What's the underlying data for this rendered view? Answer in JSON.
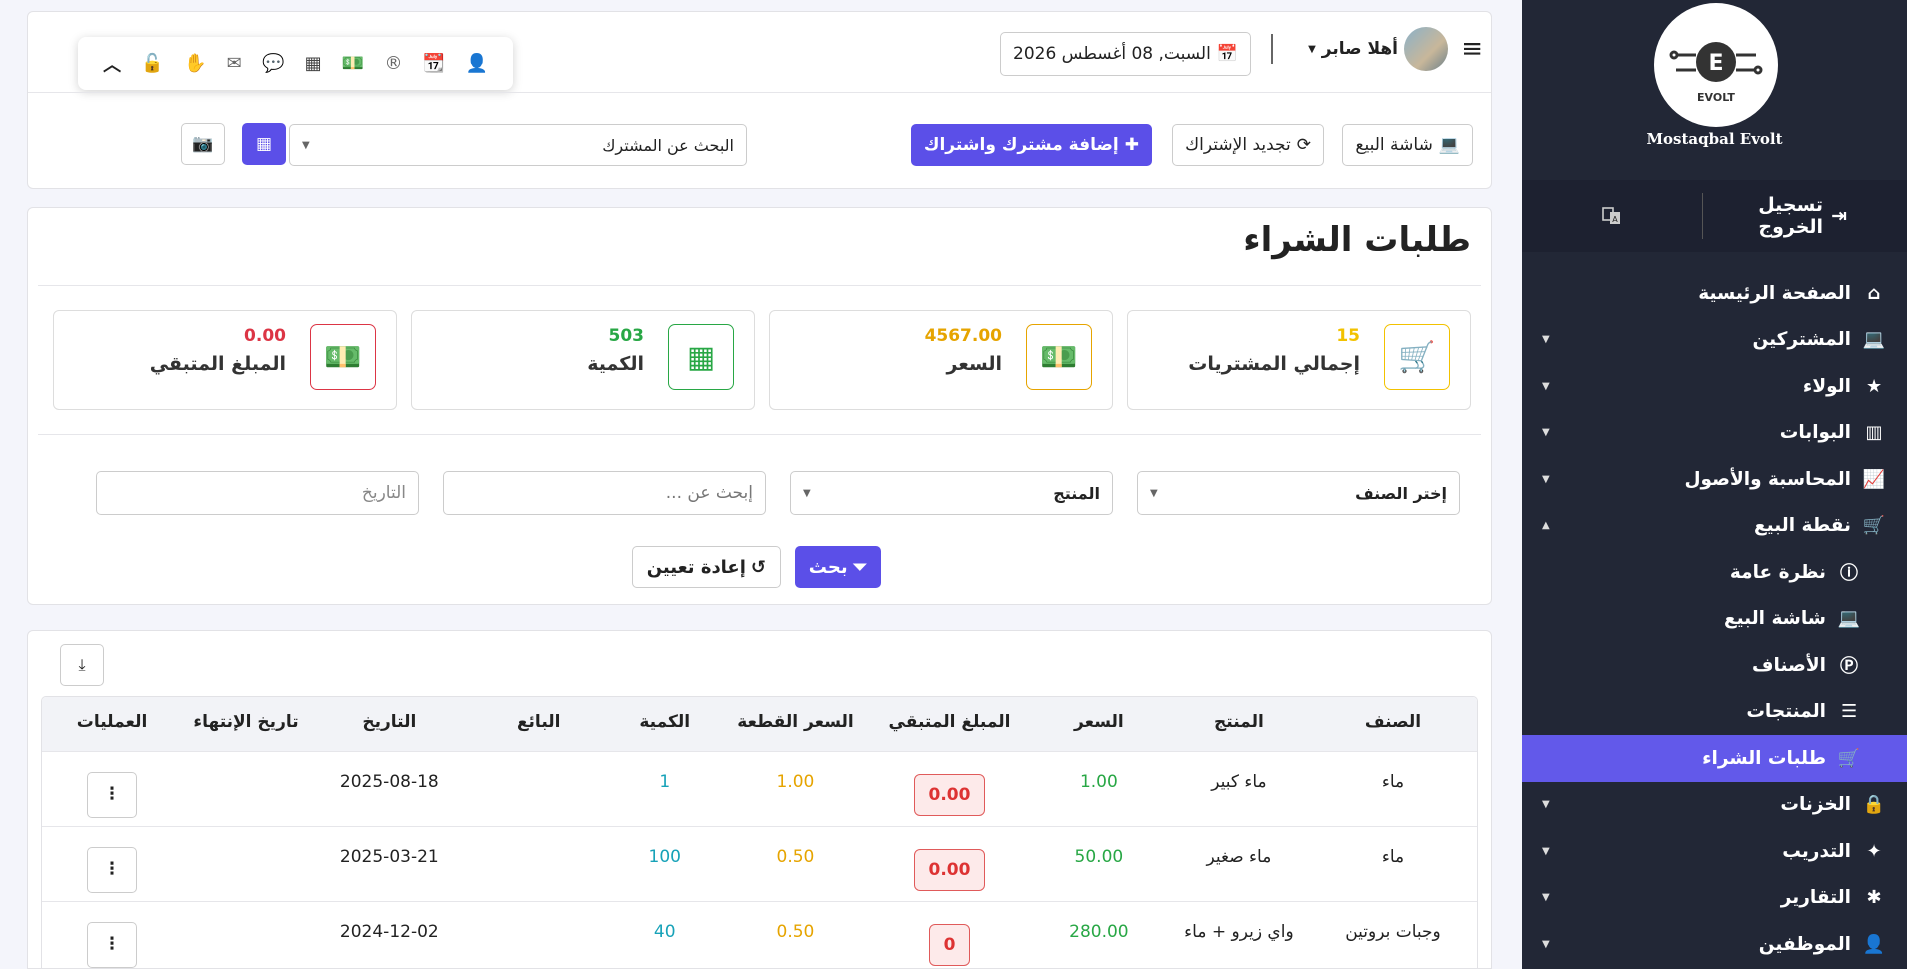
{
  "sidebar": {
    "brand": "Mostaqbal Evolt",
    "logo_text": "EVOLT",
    "logout": "تسجيل الخروج",
    "items": [
      {
        "label": "الصفحة الرئيسية",
        "icon": "home-icon"
      },
      {
        "label": "المشتركين",
        "icon": "laptop-icon",
        "caret": true
      },
      {
        "label": "الولاء",
        "icon": "star-icon",
        "caret": true
      },
      {
        "label": "البوابات",
        "icon": "building-icon",
        "caret": true
      },
      {
        "label": "المحاسبة والأصول",
        "icon": "chart-line-icon",
        "caret": true
      },
      {
        "label": "نقطة البيع",
        "icon": "cart-icon",
        "caret": true
      },
      {
        "label": "نظرة عامة",
        "icon": "info-icon",
        "sub": true
      },
      {
        "label": "شاشة البيع",
        "icon": "laptop-icon",
        "sub": true
      },
      {
        "label": "الأصناف",
        "icon": "p-circle-icon",
        "sub": true
      },
      {
        "label": "المنتجات",
        "icon": "list-icon",
        "sub": true
      },
      {
        "label": "طلبات الشراء",
        "icon": "cart-plus-icon",
        "sub": true,
        "active": true
      },
      {
        "label": "الخزنات",
        "icon": "lock-icon",
        "caret": true
      },
      {
        "label": "التدريب",
        "icon": "wand-icon",
        "caret": true
      },
      {
        "label": "التقارير",
        "icon": "bug-icon",
        "caret": true
      },
      {
        "label": "الموظفين",
        "icon": "user-icon",
        "caret": true
      }
    ]
  },
  "header": {
    "user_greeting": "أهلا صابر",
    "date": "السبت, 08 أغسطس 2026",
    "buttons": {
      "pos_screen": "شاشة البيع",
      "renew": "تجديد الإشتراك",
      "add_subscriber": "إضافة مشترك واشتراك"
    },
    "search_placeholder": "البحث عن المشترك"
  },
  "page": {
    "title": "طلبات الشراء"
  },
  "stats": [
    {
      "value": "15",
      "label": "إجمالي المشتريات",
      "color": "#f2c200"
    },
    {
      "value": "4567.00",
      "label": "السعر",
      "color": "#e6a400"
    },
    {
      "value": "503",
      "label": "الكمية",
      "color": "#28a745"
    },
    {
      "value": "0.00",
      "label": "المبلغ المتبقي",
      "color": "#dc3545"
    }
  ],
  "filters": {
    "category": "إختر الصنف",
    "product": "المنتج",
    "search": "إبحث عن ...",
    "date": "التاريخ",
    "search_btn": "بحث",
    "reset_btn": "إعادة تعيين"
  },
  "table": {
    "headers": [
      "الصنف",
      "المنتج",
      "السعر",
      "المبلغ المتبقي",
      "السعر القطعة",
      "الكمية",
      "البائع",
      "التاريخ",
      "تاريخ الإنتهاء",
      "العمليات"
    ],
    "rows": [
      {
        "category": "ماء",
        "product": "ماء كبير",
        "price": "1.00",
        "remaining": "0.00",
        "unit_price": "1.00",
        "qty": "1",
        "seller": "",
        "date": "2025-08-18",
        "expiry": ""
      },
      {
        "category": "ماء",
        "product": "ماء صغير",
        "price": "50.00",
        "remaining": "0.00",
        "unit_price": "0.50",
        "qty": "100",
        "seller": "",
        "date": "2025-03-21",
        "expiry": ""
      },
      {
        "category": "وجبات بروتين",
        "product": "واي زيرو + ماء",
        "price": "280.00",
        "remaining": "0",
        "unit_price": "0.50",
        "qty": "40",
        "seller": "",
        "date": "2024-12-02",
        "expiry": ""
      }
    ]
  }
}
